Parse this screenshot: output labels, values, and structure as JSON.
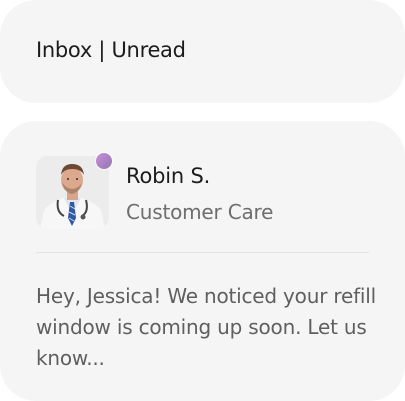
{
  "header": {
    "title": "Inbox | Unread"
  },
  "message": {
    "sender_name": "Robin S.",
    "sender_role": "Customer Care",
    "preview": "Hey, Jessica! We noticed your refill window is coming up soon. Let us know...",
    "status_color": "#b98ac9"
  }
}
